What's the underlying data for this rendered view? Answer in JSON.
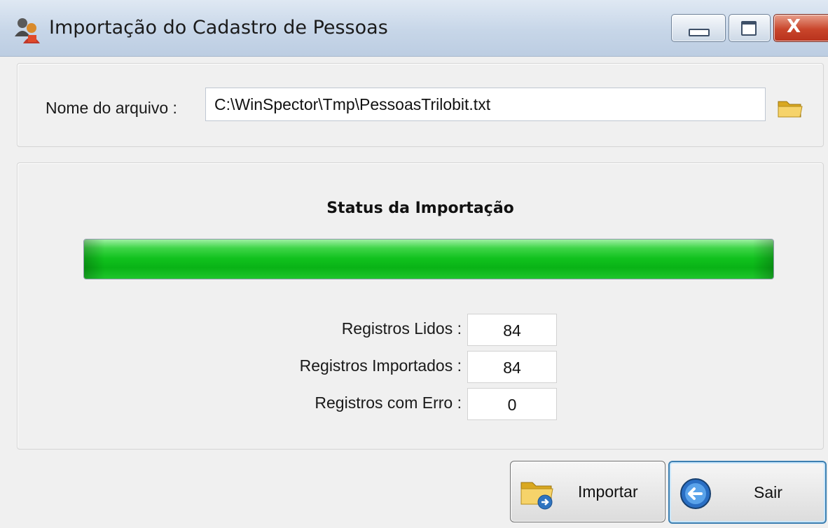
{
  "window": {
    "title": "Importação do Cadastro de Pessoas",
    "icons": {
      "app": "people-icon",
      "close": "close-icon",
      "minimize": "minimize-icon",
      "maximize": "maximize-icon"
    },
    "close_glyph": "X"
  },
  "file": {
    "label": "Nome do arquivo :",
    "value": "C:\\WinSpector\\Tmp\\PessoasTrilobit.txt",
    "browse_icon": "folder-icon"
  },
  "status": {
    "title": "Status da Importação",
    "progress_percent": 100,
    "progress_color": "#11c21e",
    "rows": [
      {
        "label": "Registros Lidos :",
        "value": "84"
      },
      {
        "label": "Registros Importados :",
        "value": "84"
      },
      {
        "label": "Registros com Erro :",
        "value": "0"
      }
    ]
  },
  "buttons": {
    "import": {
      "label": "Importar",
      "icon": "import-folder-icon"
    },
    "exit": {
      "label": "Sair",
      "icon": "exit-arrow-icon"
    }
  }
}
